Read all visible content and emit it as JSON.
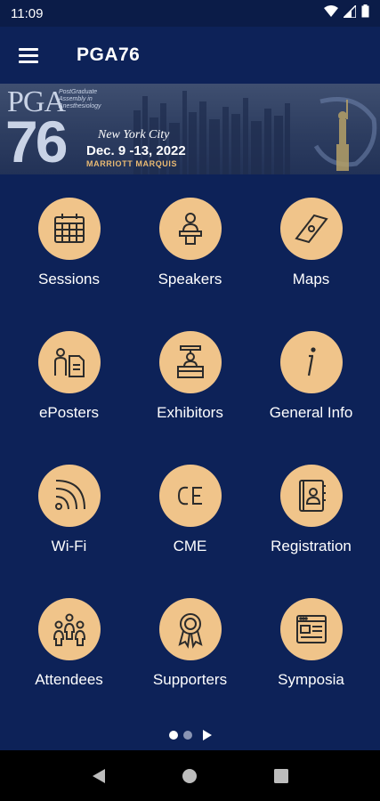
{
  "status_bar": {
    "time": "11:09",
    "icons": [
      "wifi-icon",
      "signal-icon",
      "battery-icon"
    ]
  },
  "app_bar": {
    "title": "PGA76",
    "menu_icon": "hamburger-menu-icon"
  },
  "banner": {
    "logo_letters": "PGA",
    "logo_subtitle": "PostGraduate Assembly in Anesthesiology",
    "edition": "76",
    "city": "New York City",
    "dates": "Dec. 9 -13, 2022",
    "venue": "MARRIOTT MARQUIS"
  },
  "tiles": [
    {
      "label": "Sessions",
      "icon": "calendar-icon"
    },
    {
      "label": "Speakers",
      "icon": "speaker-podium-icon"
    },
    {
      "label": "Maps",
      "icon": "compass-icon"
    },
    {
      "label": "ePosters",
      "icon": "eposter-icon"
    },
    {
      "label": "Exhibitors",
      "icon": "exhibitor-booth-icon"
    },
    {
      "label": "General Info",
      "icon": "info-icon"
    },
    {
      "label": "Wi-Fi",
      "icon": "wifi-icon"
    },
    {
      "label": "CME",
      "icon": "cme-icon"
    },
    {
      "label": "Registration",
      "icon": "address-book-icon"
    },
    {
      "label": "Attendees",
      "icon": "attendees-group-icon"
    },
    {
      "label": "Supporters",
      "icon": "award-ribbon-icon"
    },
    {
      "label": "Symposia",
      "icon": "browser-window-icon"
    }
  ],
  "tile_colors": {
    "circle": "#f0c48a",
    "icon_stroke": "#2b2b2b"
  },
  "pager": {
    "pages": 2,
    "current": 1
  },
  "nav_bar": [
    "back-icon",
    "home-icon",
    "recents-icon"
  ],
  "colors": {
    "background": "#0d2258",
    "status_bar": "#0b1c48",
    "nav_bar": "#000000"
  }
}
